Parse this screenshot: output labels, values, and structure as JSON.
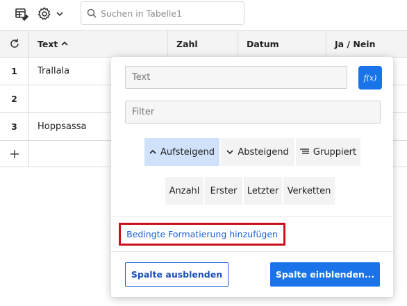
{
  "toolbar": {
    "icons": [
      "table-edit-icon",
      "gear-icon",
      "chevron-down-icon"
    ],
    "search": {
      "placeholder": "Suchen in Tabelle1",
      "value": ""
    }
  },
  "table": {
    "columns": [
      {
        "label": "Text",
        "sort": "▲"
      },
      {
        "label": "Zahl"
      },
      {
        "label": "Datum"
      },
      {
        "label": "Ja / Nein"
      }
    ],
    "rows": [
      {
        "num": "1",
        "text": "Trallala"
      },
      {
        "num": "2",
        "text": ""
      },
      {
        "num": "3",
        "text": "Hoppsassa"
      }
    ],
    "add_row_icon": "plus-icon",
    "reset_icon": "refresh-icon"
  },
  "popover": {
    "name_field": {
      "value": "",
      "placeholder": "Text"
    },
    "fx_label": "f(x)",
    "filter_field": {
      "value": "",
      "placeholder": "Filter"
    },
    "sort_buttons": [
      {
        "label": "Aufsteigend",
        "icon": "chevron-up-icon",
        "active": true
      },
      {
        "label": "Absteigend",
        "icon": "chevron-down-icon",
        "active": false
      },
      {
        "label": "Gruppiert",
        "icon": "group-lines-icon",
        "active": false
      }
    ],
    "aggregate_buttons": [
      "Anzahl",
      "Erster",
      "Letzter",
      "Verketten"
    ],
    "conditional_format_link": "Bedingte Formatierung hinzufügen",
    "hide_column_button": "Spalte ausblenden",
    "show_column_button": "Spalte einblenden...",
    "colors": {
      "accent": "#1a73e8",
      "highlight": "#cfe1fb",
      "annotation_border": "#cc0f1c"
    }
  }
}
